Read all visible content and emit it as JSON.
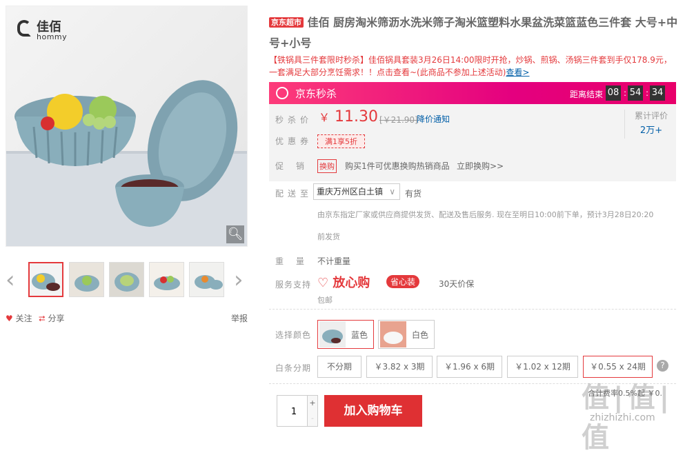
{
  "gallery": {
    "logo_cn": "佳佰",
    "logo_en": "hommy",
    "follow": "关注",
    "share": "分享",
    "report": "举报"
  },
  "product": {
    "store_tag": "京东超市",
    "title": "佳佰 厨房淘米筛沥水洗米筛子淘米篮塑料水果盆洗菜篮蓝色三件套 大号+中号+小号",
    "promo": "【铁锅具三件套限时秒杀】佳佰锅具套装3月26日14:00限时开抢，炒锅、煎锅、汤锅三件套到手仅178.9元，一套满足大部分烹饪需求！！点击查看~(此商品不参加上述活动)",
    "promo_link": "查看>"
  },
  "seckill": {
    "label": "京东秒杀",
    "ends_label": "距离结束",
    "hours": "08",
    "minutes": "54",
    "seconds": "34"
  },
  "price": {
    "label": "秒杀价",
    "symbol": "￥",
    "value": "11.30",
    "original": "[￥21.90]",
    "notify": "降价通知",
    "coupon_label": "优惠券",
    "coupon": "满1享5折",
    "promo_label": "促销",
    "promo_tag": "换购",
    "promo_text": "购买1件可优惠换购热销商品",
    "promo_link": "立即换购>>",
    "rating_label": "累计评价",
    "rating_count": "2万+"
  },
  "delivery": {
    "label": "配送至",
    "location": "重庆万州区白土镇",
    "stock": "有货",
    "notice": "由京东指定厂家或供应商提供发货、配送及售后服务. 现在至明日10:00前下单，预计3月28日20:20",
    "notice2": "前发货"
  },
  "weight": {
    "label": "重量",
    "value": "不计重量"
  },
  "service": {
    "label": "服务支持",
    "brand": "放心购",
    "badge": "省心装",
    "price_protect": "30天价保",
    "mail": "包邮"
  },
  "color": {
    "label": "选择颜色",
    "options": [
      "蓝色",
      "白色"
    ],
    "selected": "蓝色"
  },
  "installment": {
    "label": "白条分期",
    "options": [
      "不分期",
      "￥3.82 x 3期",
      "￥1.96 x 6期",
      "￥1.02 x 12期",
      "￥0.55 x 24期"
    ],
    "help": "?",
    "overflow_text": "合计费率0.5%起 ￥0.",
    "selected": "￥0.55 x 24期"
  },
  "cart": {
    "quantity": "1",
    "plus": "+",
    "minus": "-",
    "add_label": "加入购物车"
  },
  "watermark": {
    "logo": "值|值|值",
    "site": "zhizhizhi.com"
  },
  "colors": {
    "accent": "#e4393c",
    "seckill_start": "#fd3c7a",
    "seckill_end": "#e8006a",
    "link": "#005ea7"
  }
}
